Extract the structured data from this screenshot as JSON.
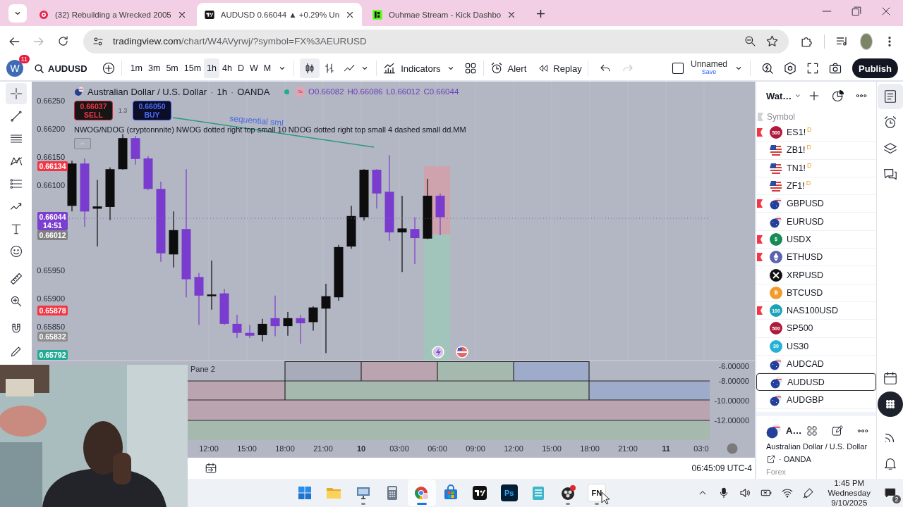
{
  "browser": {
    "tabs": [
      {
        "kind": "video",
        "title": "(32) Rebuilding a Wrecked 2005",
        "selected": false
      },
      {
        "kind": "chart",
        "title": "AUDUSD 0.66044 ▲ +0.29% Un",
        "selected": true
      },
      {
        "kind": "stream",
        "title": "Ouhmae Stream - Kick Dashbo",
        "selected": false
      }
    ],
    "forward_disabled": true,
    "url_host": "tradingview.com",
    "url_path": "/chart/W4AVyrwj/?symbol=FX%3AEURUSD"
  },
  "toolbar": {
    "avatar_letter": "W",
    "notification_count": "11",
    "symbol": "AUDUSD",
    "timeframes": [
      {
        "label": "1m",
        "selected": false
      },
      {
        "label": "3m",
        "selected": false
      },
      {
        "label": "5m",
        "selected": false
      },
      {
        "label": "15m",
        "selected": false
      },
      {
        "label": "1h",
        "selected": true
      },
      {
        "label": "4h",
        "selected": false
      },
      {
        "label": "D",
        "selected": false
      },
      {
        "label": "W",
        "selected": false
      },
      {
        "label": "M",
        "selected": false
      }
    ],
    "chart_types": [
      {
        "kind": "candles",
        "selected": true
      },
      {
        "kind": "bars",
        "selected": false
      },
      {
        "kind": "line",
        "selected": false
      }
    ],
    "indicators_label": "Indicators",
    "alert_label": "Alert",
    "replay_label": "Replay",
    "history": [
      {
        "kind": "undo",
        "disabled": false
      },
      {
        "kind": "redo",
        "disabled": true
      }
    ],
    "layout_name": "Unnamed",
    "save_label": "Save",
    "publish_label": "Publish"
  },
  "drawing_tools": [
    {
      "kind": "crosshair",
      "selected": true
    },
    {
      "kind": "trend-line",
      "selected": false
    },
    {
      "kind": "horizontal-lines",
      "selected": false
    },
    {
      "kind": "pattern",
      "selected": false
    },
    {
      "kind": "fib",
      "selected": false
    },
    {
      "kind": "path",
      "selected": false
    },
    {
      "kind": "text",
      "selected": false
    },
    {
      "kind": "emoji",
      "selected": false
    },
    {
      "kind": "ruler",
      "selected": false
    },
    {
      "kind": "zoom",
      "selected": false
    },
    {
      "kind": "magnet",
      "selected": false
    },
    {
      "kind": "pencil",
      "selected": false
    }
  ],
  "legend": {
    "items": [
      {
        "kind": "title",
        "text": "Australian Dollar / U.S. Dollar"
      },
      {
        "kind": "sep",
        "text": "·"
      },
      {
        "kind": "interval",
        "text": "1h"
      },
      {
        "kind": "sep",
        "text": "·"
      },
      {
        "kind": "exchange",
        "text": "OANDA"
      }
    ],
    "market_status": "≈",
    "ohlc": [
      "O0.66082",
      "H0.66086",
      "L0.66012",
      "C0.66044"
    ]
  },
  "trade": {
    "sell_price": "0.66037",
    "sell_label": "SELL",
    "spread": "1.3",
    "buy_price": "0.66050",
    "buy_label": "BUY"
  },
  "indicator_text": "NWOG/NDOG (cryptonnnite) NWOG dotted right top small 10 NDOG dotted right top small 4 dashed small dd.MM",
  "drawing_label": "sequential sml",
  "price_chart": {
    "chart_data": {
      "type": "candlestick",
      "ylim": [
        0.6579,
        0.66284
      ],
      "ohlc": [
        [
          0.66064,
          0.66144,
          0.66054,
          0.66139
        ],
        [
          0.66139,
          0.66148,
          0.66027,
          0.66054
        ],
        [
          0.66059,
          0.6611,
          0.65992,
          0.66063
        ],
        [
          0.66062,
          0.66132,
          0.66039,
          0.66129
        ],
        [
          0.66129,
          0.66191,
          0.66128,
          0.66184
        ],
        [
          0.66184,
          0.66188,
          0.66137,
          0.66147
        ],
        [
          0.66148,
          0.66152,
          0.66092,
          0.66094
        ],
        [
          0.66094,
          0.66107,
          0.65965,
          0.6598
        ],
        [
          0.65978,
          0.66054,
          0.65955,
          0.66021
        ],
        [
          0.66023,
          0.66129,
          0.65902,
          0.65934
        ],
        [
          0.65938,
          0.65945,
          0.65853,
          0.65905
        ],
        [
          0.65904,
          0.65967,
          0.6588,
          0.65907
        ],
        [
          0.65909,
          0.65917,
          0.65853,
          0.65855
        ],
        [
          0.65855,
          0.65871,
          0.6583,
          0.65839
        ],
        [
          0.65839,
          0.65853,
          0.6583,
          0.65834
        ],
        [
          0.65835,
          0.65864,
          0.65824,
          0.65855
        ],
        [
          0.65865,
          0.65905,
          0.65833,
          0.65851
        ],
        [
          0.65851,
          0.65876,
          0.65834,
          0.65865
        ],
        [
          0.65865,
          0.65871,
          0.6582,
          0.65856
        ],
        [
          0.65858,
          0.65886,
          0.65843,
          0.65884
        ],
        [
          0.65882,
          0.65926,
          0.65803,
          0.65904
        ],
        [
          0.65902,
          0.65995,
          0.65896,
          0.65991
        ],
        [
          0.65992,
          0.66064,
          0.65988,
          0.66046
        ],
        [
          0.66044,
          0.66129,
          0.66038,
          0.66128
        ],
        [
          0.66128,
          0.66129,
          0.66059,
          0.66086
        ],
        [
          0.66089,
          0.66154,
          0.66002,
          0.66017
        ],
        [
          0.66017,
          0.66082,
          0.65947,
          0.66024
        ],
        [
          0.66023,
          0.66044,
          0.65961,
          0.66007
        ],
        [
          0.66006,
          0.66112,
          0.66005,
          0.66082
        ],
        [
          0.66082,
          0.66086,
          0.66012,
          0.66044
        ]
      ],
      "yticks": [
        {
          "value": 0.6625,
          "label": "0.66250"
        },
        {
          "value": 0.662,
          "label": "0.66200"
        },
        {
          "value": 0.6615,
          "label": "0.66150"
        },
        {
          "value": 0.661,
          "label": "0.66100"
        },
        {
          "value": 0.6595,
          "label": "0.65950"
        },
        {
          "value": 0.659,
          "label": "0.65900"
        },
        {
          "value": 0.6585,
          "label": "0.65850"
        }
      ]
    }
  },
  "price_tags": [
    {
      "value": "0.66134",
      "color": "#f23645"
    },
    {
      "value": "0.66044",
      "sub": "14:51",
      "color": "#7b3fd0"
    },
    {
      "value": "0.66012",
      "color": "#808080"
    },
    {
      "value": "0.65878",
      "color": "#f23645"
    },
    {
      "value": "0.65832",
      "color": "#8c8c8c"
    },
    {
      "value": "0.65792",
      "color": "#22ab94"
    }
  ],
  "pane2": {
    "title": "Pane 2",
    "axis": [
      "-6.00000",
      "-8.00000",
      "-10.00000",
      "-12.00000"
    ]
  },
  "time_axis": [
    {
      "kind": "time",
      "label": "12:00"
    },
    {
      "kind": "time",
      "label": "15:00"
    },
    {
      "kind": "time",
      "label": "18:00"
    },
    {
      "kind": "time",
      "label": "21:00"
    },
    {
      "kind": "day",
      "label": "10"
    },
    {
      "kind": "time",
      "label": "03:00"
    },
    {
      "kind": "time",
      "label": "06:00"
    },
    {
      "kind": "time",
      "label": "09:00"
    },
    {
      "kind": "time",
      "label": "12:00"
    },
    {
      "kind": "time",
      "label": "15:00"
    },
    {
      "kind": "time",
      "label": "18:00"
    },
    {
      "kind": "time",
      "label": "21:00"
    },
    {
      "kind": "day",
      "label": "11"
    },
    {
      "kind": "time",
      "label": "03:0"
    }
  ],
  "clock": "06:45:09 UTC-4",
  "watchlist": {
    "title": "Wat…",
    "column": "Symbol",
    "items": [
      {
        "symbol": "ES1!",
        "flagged": true,
        "kind": "badge",
        "icon_text": "500",
        "color": "#b0193b",
        "suffix": "D",
        "selected": false
      },
      {
        "symbol": "ZB1!",
        "flagged": false,
        "kind": "us-flag",
        "suffix": "D",
        "selected": false
      },
      {
        "symbol": "TN1!",
        "flagged": false,
        "kind": "us-flag",
        "suffix": "D",
        "selected": false
      },
      {
        "symbol": "ZF1!",
        "flagged": false,
        "kind": "us-flag",
        "suffix": "D",
        "selected": false
      },
      {
        "symbol": "GBPUSD",
        "flagged": true,
        "kind": "pair",
        "selected": false
      },
      {
        "symbol": "EURUSD",
        "flagged": false,
        "kind": "pair",
        "selected": false
      },
      {
        "symbol": "USDX",
        "flagged": true,
        "kind": "badge",
        "icon_text": "$",
        "color": "#178a55",
        "selected": false
      },
      {
        "symbol": "ETHUSD",
        "flagged": true,
        "kind": "eth",
        "color": "#5c62b0",
        "selected": false
      },
      {
        "symbol": "XRPUSD",
        "flagged": false,
        "kind": "xrp",
        "color": "#111111",
        "selected": false
      },
      {
        "symbol": "BTCUSD",
        "flagged": false,
        "kind": "badge",
        "icon_text": "₿",
        "color": "#f29b2a",
        "selected": false
      },
      {
        "symbol": "NAS100USD",
        "flagged": true,
        "kind": "badge",
        "icon_text": "100",
        "color": "#1aa3b8",
        "selected": false
      },
      {
        "symbol": "SP500",
        "flagged": false,
        "kind": "badge",
        "icon_text": "500",
        "color": "#b0193b",
        "selected": false
      },
      {
        "symbol": "US30",
        "flagged": false,
        "kind": "badge",
        "icon_text": "30",
        "color": "#28b1d6",
        "selected": false
      },
      {
        "symbol": "AUDCAD",
        "flagged": false,
        "kind": "pair",
        "selected": false
      },
      {
        "symbol": "AUDUSD",
        "flagged": false,
        "kind": "pair",
        "selected": true
      },
      {
        "symbol": "AUDGBP",
        "flagged": false,
        "kind": "pair",
        "selected": false
      }
    ],
    "details": {
      "short": "A…",
      "name": "Australian Dollar / U.S. Dollar",
      "exchange": "· OANDA",
      "type": "Forex"
    }
  },
  "side_panel": [
    {
      "kind": "watchlist",
      "selected": true
    },
    {
      "kind": "alerts",
      "selected": false
    },
    {
      "kind": "layers",
      "selected": false
    },
    {
      "kind": "chat",
      "selected": false
    },
    {
      "kind": "calendar",
      "selected": false
    },
    {
      "kind": "apps",
      "selected": false
    },
    {
      "kind": "signals",
      "selected": false
    },
    {
      "kind": "notifications",
      "selected": false
    }
  ],
  "taskbar": {
    "apps": [
      {
        "kind": "start",
        "running": false,
        "selected": false
      },
      {
        "kind": "folder",
        "running": false,
        "selected": false
      },
      {
        "kind": "remote",
        "running": true,
        "selected": false
      },
      {
        "kind": "calculator",
        "running": false,
        "selected": false
      },
      {
        "kind": "browser",
        "running": true,
        "selected": true
      },
      {
        "kind": "store",
        "running": false,
        "selected": false
      },
      {
        "kind": "chart-app",
        "running": false,
        "selected": false
      },
      {
        "kind": "photo-editor",
        "text": "Ps",
        "running": false,
        "selected": false
      },
      {
        "kind": "notepad",
        "running": false,
        "selected": false
      },
      {
        "kind": "recorder",
        "running": true,
        "selected": false
      },
      {
        "kind": "fn-app",
        "text": "FN",
        "running": true,
        "selected": false
      }
    ],
    "time": "1:45 PM",
    "day": "Wednesday",
    "date": "9/10/2025",
    "notifications": "2"
  }
}
